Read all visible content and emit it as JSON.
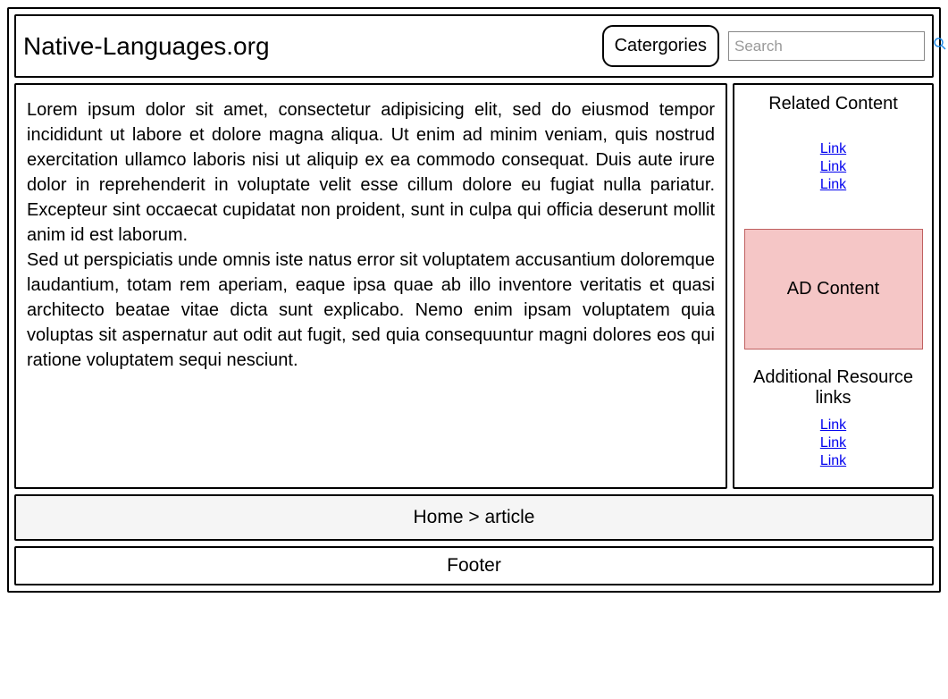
{
  "header": {
    "site_title": "Native-Languages.org",
    "categories_label": "Catergories",
    "search_placeholder": "Search"
  },
  "article": {
    "paragraph1": "Lorem ipsum dolor sit amet, consectetur adipisicing elit, sed do eiusmod tempor incididunt ut labore et dolore magna aliqua. Ut enim ad minim veniam, quis nostrud exercitation ullamco laboris nisi ut aliquip ex ea commodo consequat. Duis aute irure dolor in reprehenderit in voluptate velit esse cillum dolore eu fugiat nulla pariatur. Excepteur sint occaecat cupidatat non proident, sunt in culpa qui officia deserunt mollit anim id est laborum.",
    "paragraph2": "Sed ut perspiciatis unde omnis iste natus error sit voluptatem accusantium doloremque laudantium, totam rem aperiam, eaque ipsa quae ab illo inventore veritatis et quasi architecto beatae vitae dicta sunt explicabo. Nemo enim ipsam voluptatem quia voluptas sit aspernatur aut odit aut fugit, sed quia consequuntur magni dolores eos qui ratione voluptatem sequi nesciunt."
  },
  "sidebar": {
    "related_heading": "Related Content",
    "related_links": [
      "Link",
      "Link",
      "Link"
    ],
    "ad_label": "AD Content",
    "additional_heading": "Additional Resource links",
    "resource_links": [
      "Link",
      "Link",
      "Link"
    ]
  },
  "breadcrumb": {
    "text": "Home > article"
  },
  "footer": {
    "text": "Footer"
  }
}
